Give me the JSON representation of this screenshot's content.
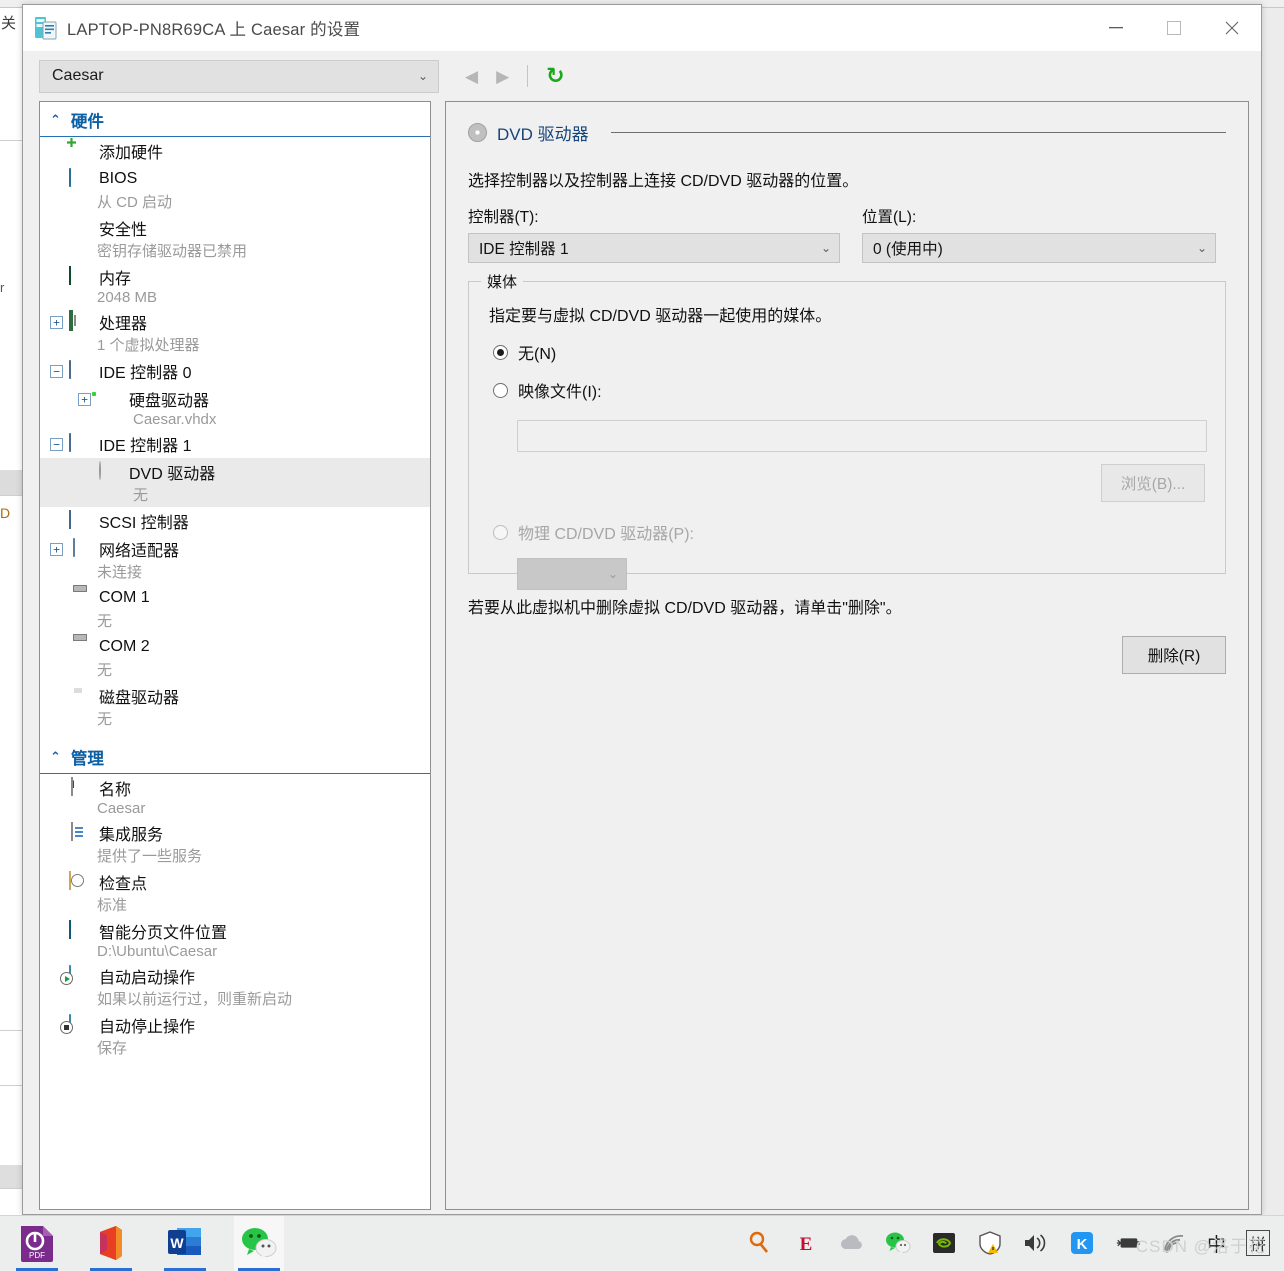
{
  "background": {
    "left_fragment_1": "关",
    "left_fragment_2": "r",
    "left_fragment_3": "D"
  },
  "window": {
    "title": "LAPTOP-PN8R69CA 上 Caesar 的设置",
    "icon": "vm-settings-icon",
    "controls": {
      "minimize": "—",
      "maximize": "☐",
      "close": "✕"
    }
  },
  "toolbar": {
    "vm_selector_value": "Caesar",
    "back_label": "◀",
    "forward_label": "▶",
    "refresh_label": "↻"
  },
  "tree": {
    "sections": [
      {
        "title": "硬件",
        "chevron": "⌃",
        "items": [
          {
            "label": "添加硬件",
            "sub": "",
            "icon": "add-hardware-icon",
            "expander": "",
            "level": 1
          },
          {
            "label": "BIOS",
            "sub": "从 CD 启动",
            "icon": "bios-icon",
            "expander": "",
            "level": 1
          },
          {
            "label": "安全性",
            "sub": "密钥存储驱动器已禁用",
            "icon": "security-shield-icon",
            "expander": "",
            "level": 1
          },
          {
            "label": "内存",
            "sub": "2048 MB",
            "icon": "memory-icon",
            "expander": "",
            "level": 1
          },
          {
            "label": "处理器",
            "sub": "1 个虚拟处理器",
            "icon": "processor-icon",
            "expander": "+",
            "level": 1
          },
          {
            "label": "IDE 控制器 0",
            "sub": "",
            "icon": "ide-controller-icon",
            "expander": "−",
            "level": 1
          },
          {
            "label": "硬盘驱动器",
            "sub": "Caesar.vhdx",
            "icon": "hard-drive-icon",
            "expander": "+",
            "level": 2
          },
          {
            "label": "IDE 控制器 1",
            "sub": "",
            "icon": "ide-controller-icon",
            "expander": "−",
            "level": 1
          },
          {
            "label": "DVD 驱动器",
            "sub": "无",
            "icon": "dvd-drive-icon",
            "expander": "",
            "level": 2,
            "selected": true
          },
          {
            "label": "SCSI 控制器",
            "sub": "",
            "icon": "scsi-controller-icon",
            "expander": "",
            "level": 1
          },
          {
            "label": "网络适配器",
            "sub": "未连接",
            "icon": "network-adapter-icon",
            "expander": "+",
            "level": 1
          },
          {
            "label": "COM 1",
            "sub": "无",
            "icon": "com-port-icon",
            "expander": "",
            "level": 1
          },
          {
            "label": "COM 2",
            "sub": "无",
            "icon": "com-port-icon",
            "expander": "",
            "level": 1
          },
          {
            "label": "磁盘驱动器",
            "sub": "无",
            "icon": "floppy-drive-icon",
            "expander": "",
            "level": 1
          }
        ]
      },
      {
        "title": "管理",
        "chevron": "⌃",
        "items": [
          {
            "label": "名称",
            "sub": "Caesar",
            "icon": "name-icon",
            "expander": "",
            "level": 1
          },
          {
            "label": "集成服务",
            "sub": "提供了一些服务",
            "icon": "integration-services-icon",
            "expander": "",
            "level": 1
          },
          {
            "label": "检查点",
            "sub": "标准",
            "icon": "checkpoint-icon",
            "expander": "",
            "level": 1
          },
          {
            "label": "智能分页文件位置",
            "sub": "D:\\Ubuntu\\Caesar",
            "icon": "smart-paging-icon",
            "expander": "",
            "level": 1
          },
          {
            "label": "自动启动操作",
            "sub": "如果以前运行过，则重新启动",
            "icon": "automatic-start-icon",
            "expander": "",
            "level": 1
          },
          {
            "label": "自动停止操作",
            "sub": "保存",
            "icon": "automatic-stop-icon",
            "expander": "",
            "level": 1
          }
        ]
      }
    ]
  },
  "detail": {
    "header_title": "DVD 驱动器",
    "header_icon": "dvd-disc-icon",
    "description": "选择控制器以及控制器上连接 CD/DVD 驱动器的位置。",
    "controller_label": "控制器(T):",
    "controller_value": "IDE 控制器 1",
    "location_label": "位置(L):",
    "location_value": "0 (使用中)",
    "media_group_legend": "媒体",
    "media_description": "指定要与虚拟 CD/DVD 驱动器一起使用的媒体。",
    "radio_none_label": "无(N)",
    "radio_image_label": "映像文件(I):",
    "image_path_value": "",
    "browse_button": "浏览(B)...",
    "radio_physical_label": "物理 CD/DVD 驱动器(P):",
    "physical_drive_value": "",
    "remove_note": "若要从此虚拟机中删除虚拟 CD/DVD 驱动器，请单击\"删除\"。",
    "delete_button": "删除(R)"
  },
  "taskbar": {
    "apps": [
      {
        "name": "pdf-reader-icon",
        "glyph": "PDF"
      },
      {
        "name": "office-icon",
        "glyph": "O"
      },
      {
        "name": "word-icon",
        "glyph": "W"
      },
      {
        "name": "wechat-icon",
        "glyph": ""
      }
    ],
    "tray": [
      {
        "name": "search-magnifier-icon"
      },
      {
        "name": "euro-dict-icon"
      },
      {
        "name": "cloud-icon"
      },
      {
        "name": "wechat-tray-icon"
      },
      {
        "name": "nvidia-icon"
      },
      {
        "name": "security-shield-warning-icon"
      },
      {
        "name": "volume-icon"
      },
      {
        "name": "kingsoft-icon"
      },
      {
        "name": "battery-icon"
      },
      {
        "name": "wifi-icon"
      }
    ],
    "ime_mode": "中",
    "ime_pinyin": "拼",
    "watermark": "CSDN @洛于花"
  }
}
